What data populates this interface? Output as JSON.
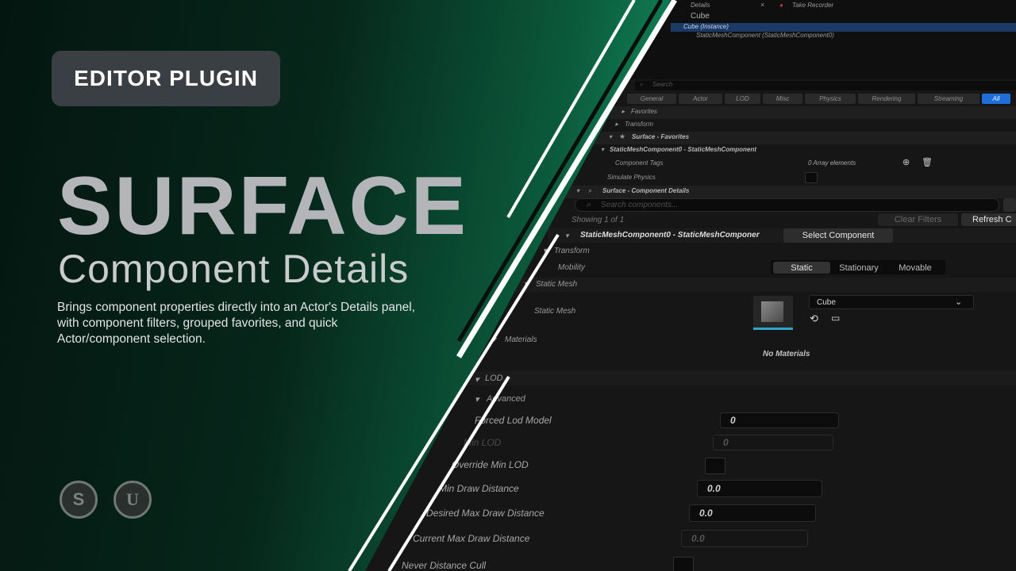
{
  "hero": {
    "badge": "EDITOR PLUGIN",
    "title": "SURFACE",
    "subtitle": "Component Details",
    "description": "Brings component properties directly into an Actor's Details panel, with component filters, grouped favorites, and quick Actor/component selection.",
    "logo_a": "S",
    "logo_b": "U"
  },
  "panel": {
    "tabs_bar": {
      "details": "Details",
      "take_recorder": "Take Recorder",
      "close": "×"
    },
    "actor_name": "Cube",
    "instance": "Cube (Instance)",
    "component": "StaticMeshComponent (StaticMeshComponent0)",
    "search_placeholder": "Search",
    "filter_tabs": [
      "General",
      "Actor",
      "LOD",
      "Misc",
      "Physics",
      "Rendering",
      "Streaming",
      "All"
    ],
    "sections": {
      "favorites": "Favorites",
      "transform": "Transform",
      "surface_favorites": "Surface - Favorites",
      "smc_header": "StaticMeshComponent0 - StaticMeshComponent",
      "component_tags": "Component Tags",
      "array_elements": "0 Array elements",
      "simulate_physics": "Simulate Physics",
      "surface_details": "Surface - Component Details"
    },
    "search_components_placeholder": "Search components...",
    "showing": "Showing 1 of 1",
    "clear_filters": "Clear Filters",
    "refresh": "Refresh C",
    "component_header": "StaticMeshComponent0 - StaticMeshComponer",
    "select_component": "Select Component",
    "transform": "Transform",
    "mobility": "Mobility",
    "mobility_options": [
      "Static",
      "Stationary",
      "Movable"
    ],
    "static_mesh_section": "Static Mesh",
    "static_mesh_label": "Static Mesh",
    "mesh_value": "Cube",
    "materials": "Materials",
    "no_materials": "No Materials",
    "lod": "LOD",
    "advanced": "Advanced",
    "forced_lod": "Forced Lod Model",
    "forced_lod_value": "0",
    "min_lod": "Min LOD",
    "min_lod_value": "0",
    "override_min_lod": "Override Min LOD",
    "min_draw": "Min Draw Distance",
    "min_draw_value": "0.0",
    "desired_max": "Desired Max Draw Distance",
    "desired_max_value": "0.0",
    "current_max": "Current Max Draw Distance",
    "current_max_value": "0.0",
    "never_cull": "Never Distance Cull"
  },
  "colors": {
    "accent": "#149a68",
    "selected_tab": "#1e6fd9"
  }
}
